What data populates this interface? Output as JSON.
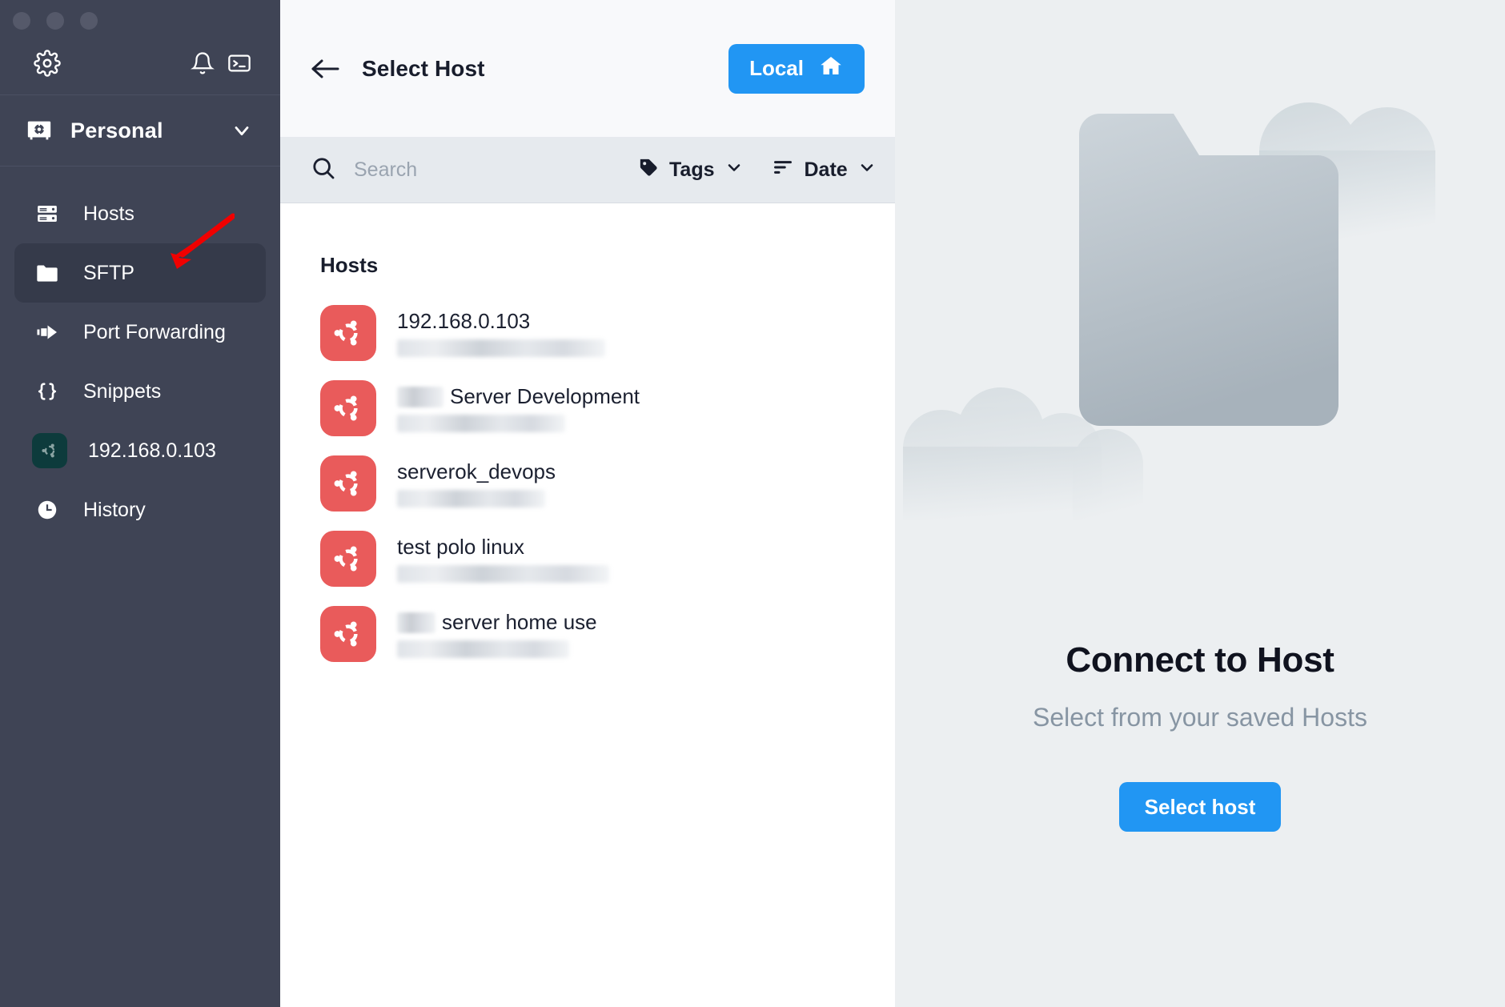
{
  "window": {
    "traffic_lights": [
      "close",
      "minimize",
      "maximize"
    ]
  },
  "sidebar": {
    "tools": [
      {
        "name": "settings-icon",
        "label": "Settings"
      },
      {
        "name": "bell-icon",
        "label": "Notifications"
      },
      {
        "name": "terminal-icon",
        "label": "Terminal"
      }
    ],
    "vault": {
      "label": "Personal",
      "icon": "vault-icon",
      "chevron": "chevron-down-icon"
    },
    "items": [
      {
        "label": "Hosts",
        "icon": "server-icon",
        "active": false
      },
      {
        "label": "SFTP",
        "icon": "folder-icon",
        "active": true
      },
      {
        "label": "Port Forwarding",
        "icon": "port-forward-icon",
        "active": false
      },
      {
        "label": "Snippets",
        "icon": "braces-icon",
        "active": false
      },
      {
        "label": "192.168.0.103",
        "icon": "ubuntu-icon",
        "active": false
      },
      {
        "label": "History",
        "icon": "clock-icon",
        "active": false
      }
    ]
  },
  "middle": {
    "back_label": "Back",
    "title": "Select Host",
    "local_button": {
      "label": "Local",
      "icon": "home-icon"
    },
    "search": {
      "placeholder": "Search",
      "value": "",
      "icon": "search-icon"
    },
    "filters": [
      {
        "label": "Tags",
        "icon": "tag-icon",
        "chevron": "chevron-down-icon"
      },
      {
        "label": "Date",
        "icon": "sort-icon",
        "chevron": "chevron-down-icon"
      }
    ],
    "list_heading": "Hosts",
    "hosts": [
      {
        "name": "192.168.0.103",
        "name_prefix_redacted": false,
        "subtitle_redacted": true,
        "icon": "ubuntu-icon"
      },
      {
        "name": "Server Development",
        "name_prefix_redacted": true,
        "subtitle_redacted": true,
        "icon": "ubuntu-icon"
      },
      {
        "name": "serverok_devops",
        "name_prefix_redacted": false,
        "subtitle_redacted": true,
        "icon": "ubuntu-icon"
      },
      {
        "name": "test polo linux",
        "name_prefix_redacted": false,
        "subtitle_redacted": true,
        "icon": "ubuntu-icon"
      },
      {
        "name": "server home use",
        "name_prefix_redacted": true,
        "subtitle_redacted": true,
        "icon": "ubuntu-icon"
      }
    ]
  },
  "right": {
    "illustration": "folder-and-clouds-illustration",
    "title": "Connect to Host",
    "subtitle": "Select from your saved Hosts",
    "button_label": "Select host"
  },
  "annotations": {
    "arrows": [
      {
        "name": "arrow-to-local-button",
        "color": "#f00000"
      },
      {
        "name": "arrow-to-sftp-item",
        "color": "#f00000"
      },
      {
        "name": "arrow-to-select-host-button",
        "color": "#f00000"
      }
    ]
  },
  "colors": {
    "sidebar_bg": "#3f4455",
    "sidebar_active": "#353a4a",
    "accent_blue": "#2196f3",
    "ubuntu_red": "#e95b5b",
    "annotation_red": "#f00000",
    "right_panel_bg": "#eceff1",
    "filter_bar_bg": "#e6eaee"
  }
}
